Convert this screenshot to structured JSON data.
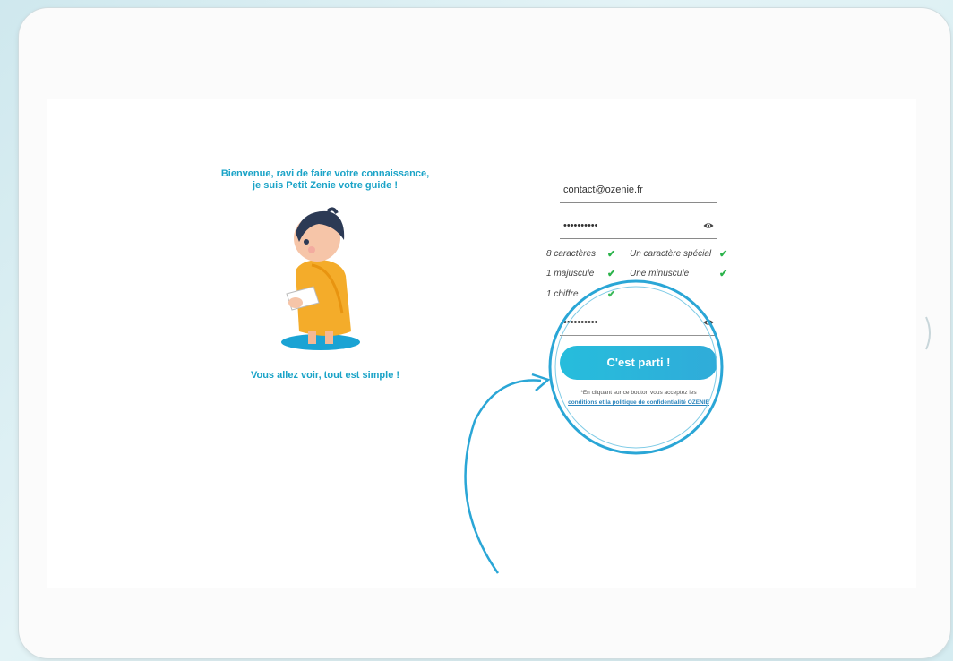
{
  "welcome": {
    "line1": "Bienvenue, ravi de faire votre connaissance,",
    "line2": "je suis Petit Zenie votre guide !",
    "tagline": "Vous allez voir, tout est simple !"
  },
  "form": {
    "email_value": "contact@ozenie.fr",
    "password_mask": "••••••••••",
    "confirm_mask": "••••••••••",
    "rules": [
      {
        "label": "8 caractères"
      },
      {
        "label": "Un caractère spécial"
      },
      {
        "label": "1 majuscule"
      },
      {
        "label": "Une minuscule"
      },
      {
        "label": "1 chiffre"
      }
    ],
    "check_glyph": "✔",
    "submit_label": "C'est parti !",
    "legal_text": "*En cliquant sur ce bouton vous acceptez les",
    "legal_link": "conditions et la politique de confidentialité OZENIE"
  },
  "colors": {
    "accent": "#1aa3c7",
    "button": "#18aed8",
    "check": "#2bb34b",
    "annotation": "#2aa6d6"
  },
  "icons": [
    "eye-icon",
    "check-icon",
    "character-illustration"
  ]
}
